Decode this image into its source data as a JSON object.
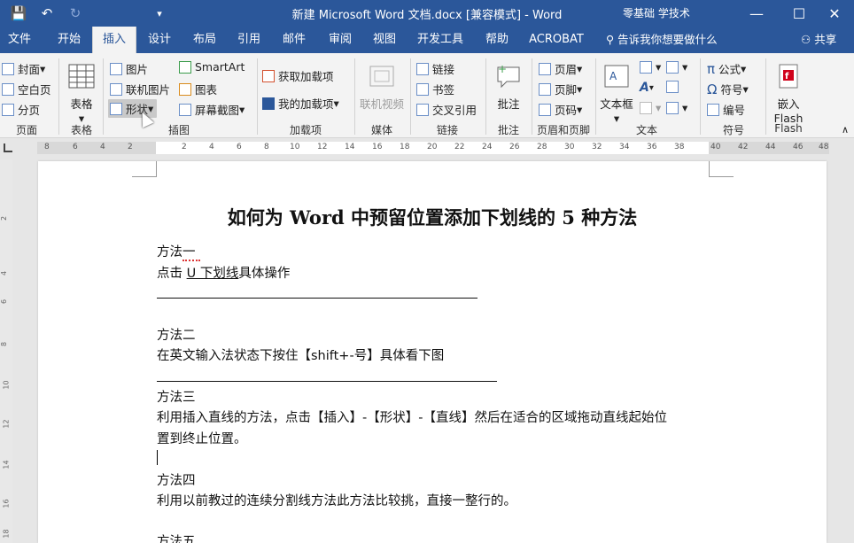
{
  "titlebar": {
    "title": "新建 Microsoft Word 文档.docx [兼容模式]  -  Word",
    "user": "零基础 学技术",
    "minimize": "—",
    "restore": "☐",
    "close": "✕",
    "qa_save": "💾",
    "qa_undo": "↶",
    "qa_redo": "↻",
    "qa_more": "▾"
  },
  "tabs": [
    "文件",
    "开始",
    "插入",
    "设计",
    "布局",
    "引用",
    "邮件",
    "审阅",
    "视图",
    "开发工具",
    "帮助",
    "ACROBAT"
  ],
  "active_tab": "插入",
  "tellme": "告诉我你想要做什么",
  "share": "共享",
  "ribbon": {
    "pages": {
      "cover": "封面",
      "blank": "空白页",
      "break": "分页",
      "label": "页面"
    },
    "tables": {
      "table": "表格",
      "label": "表格"
    },
    "illustrations": {
      "picture": "图片",
      "online_picture": "联机图片",
      "shapes": "形状",
      "smartart": "SmartArt",
      "chart": "图表",
      "screenshot": "屏幕截图",
      "label": "插图"
    },
    "addins": {
      "get": "获取加载项",
      "my": "我的加载项",
      "label": "加载项"
    },
    "media": {
      "online_video": "联机视频",
      "label": "媒体"
    },
    "links": {
      "link": "链接",
      "bookmark": "书签",
      "crossref": "交叉引用",
      "label": "链接"
    },
    "comments": {
      "comment": "批注",
      "label": "批注"
    },
    "header_footer": {
      "header": "页眉",
      "footer": "页脚",
      "page_number": "页码",
      "label": "页眉和页脚"
    },
    "text": {
      "textbox": "文本框",
      "label": "文本"
    },
    "symbols": {
      "equation": "公式",
      "symbol": "符号",
      "number": "编号",
      "label": "符号"
    },
    "flash": {
      "embed": "嵌入",
      "flash": "Flash",
      "label": "Flash"
    }
  },
  "ruler": [
    "8",
    "6",
    "4",
    "2",
    "2",
    "4",
    "6",
    "8",
    "10",
    "12",
    "14",
    "16",
    "18",
    "20",
    "22",
    "24",
    "26",
    "28",
    "30",
    "32",
    "34",
    "36",
    "38",
    "40",
    "42",
    "44",
    "46",
    "48"
  ],
  "vruler": [
    "2",
    "4",
    "6",
    "8",
    "10",
    "12",
    "14",
    "16",
    "18"
  ],
  "document": {
    "title": "如何为 Word 中预留位置添加下划线的 5 种方法",
    "m1_head": "方法一",
    "m1_pre": "点击 ",
    "m1_ul": "U 下划线",
    "m1_post": "具体操作",
    "m2_head": "方法二",
    "m2_body": "在英文输入法状态下按住【shift+-号】具体看下图",
    "m3_head": "方法三",
    "m3_body1": "利用插入直线的方法，点击【插入】-【形状】-【直线】然后在适合的区域拖动直线起始位",
    "m3_body2": "置到终止位置。",
    "m4_head": "方法四",
    "m4_body": "利用以前教过的连续分割线方法此方法比较挑，直接一整行的。",
    "m5_head": "方法五"
  }
}
